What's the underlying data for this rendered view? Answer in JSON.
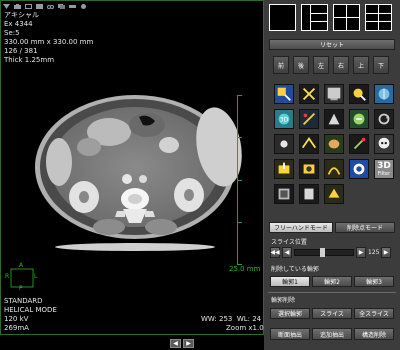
{
  "overlay": {
    "patient_name": "アキシャル",
    "exam": "Ex 4344",
    "series": "Se:5",
    "fov": "330.00 mm x 330.00 mm",
    "image_index": "126 / 381",
    "thickness": "Thick 1.25mm",
    "scale_label": "25.0 mm",
    "kernel": "STANDARD",
    "mode": "HELICAL MODE",
    "kv": "120 kV",
    "ma": "269mA",
    "window": "WW: 253  WL: 24",
    "zoom": "Zoom x1.0",
    "orientation": {
      "top": "A",
      "left": "R",
      "right": "L",
      "bottom": "P"
    }
  },
  "panel": {
    "reset_label": "リセット",
    "directions": [
      "前",
      "後",
      "左",
      "右",
      "上",
      "下"
    ],
    "tools": [
      "select-tool",
      "pan-tool",
      "window-tool",
      "magnify-tool",
      "measure-tool",
      "mpr-tool",
      "cut-tool",
      "render-tool",
      "invert-tool",
      "rotate-tool",
      "point-tool",
      "fly-tool",
      "skin-tool",
      "annotate-tool",
      "skull-tool",
      "export-tool",
      "capture-tool",
      "vessel-tool",
      "cap-tool",
      "3d-filter-tool",
      "film-tool",
      "extract-tool",
      "region-tool"
    ],
    "filter_label": "3D",
    "filter_sub": "Filter",
    "mode_tabs": [
      "フリーハンドモード",
      "削除点モード"
    ],
    "slice_position_label": "スライス位置",
    "slice_value": "125",
    "contour_section_label": "削除している輪郭",
    "contour_buttons": [
      "輪郭1",
      "輪郭2",
      "輪郭3"
    ],
    "delete_section_label": "輪郭削除",
    "delete_buttons": [
      "選択輪郭",
      "スライス",
      "全スライス"
    ],
    "action_buttons": [
      "断面抽出",
      "追加抽出",
      "構造削除"
    ]
  },
  "colors": {
    "accent_green": "#2bb52b",
    "panel_bg": "#3c3c3c"
  }
}
